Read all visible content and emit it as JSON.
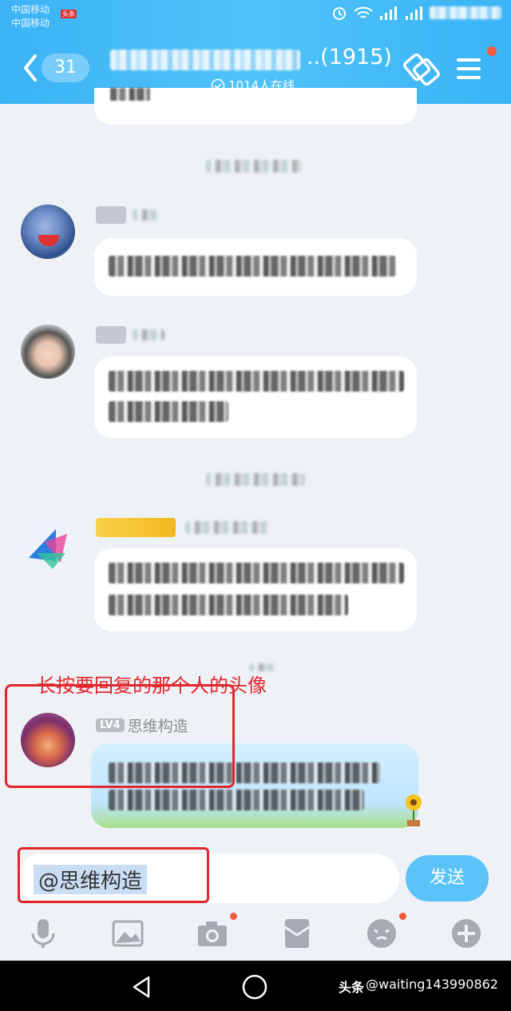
{
  "status_bar": {
    "carrier_1": "中国移动",
    "carrier_2": "中国移动",
    "carrier_badge": "头条"
  },
  "header": {
    "unread_count": "31",
    "group_member_count": "..(1915)",
    "online_text": "1014人在线"
  },
  "messages": {
    "last_user_level": "LV4",
    "last_user_name": "思维构造"
  },
  "annotation": {
    "text": "长按要回复的那个人的头像"
  },
  "input": {
    "value": "@思维构造",
    "send_label": "发送"
  },
  "watermark": {
    "brand": "头条",
    "handle": "@waiting143990862"
  },
  "colors": {
    "header_blue": "#4fc2f8",
    "send_button": "#5bc3f7",
    "annotation_red": "#e2262b",
    "badge_red": "#f25b3a"
  },
  "icons": [
    "back-chevron-icon",
    "eye-icon",
    "group-exchange-icon",
    "menu-icon",
    "microphone-icon",
    "image-icon",
    "camera-icon",
    "red-packet-icon",
    "emoji-icon",
    "plus-icon",
    "nav-back-icon",
    "nav-home-icon"
  ]
}
